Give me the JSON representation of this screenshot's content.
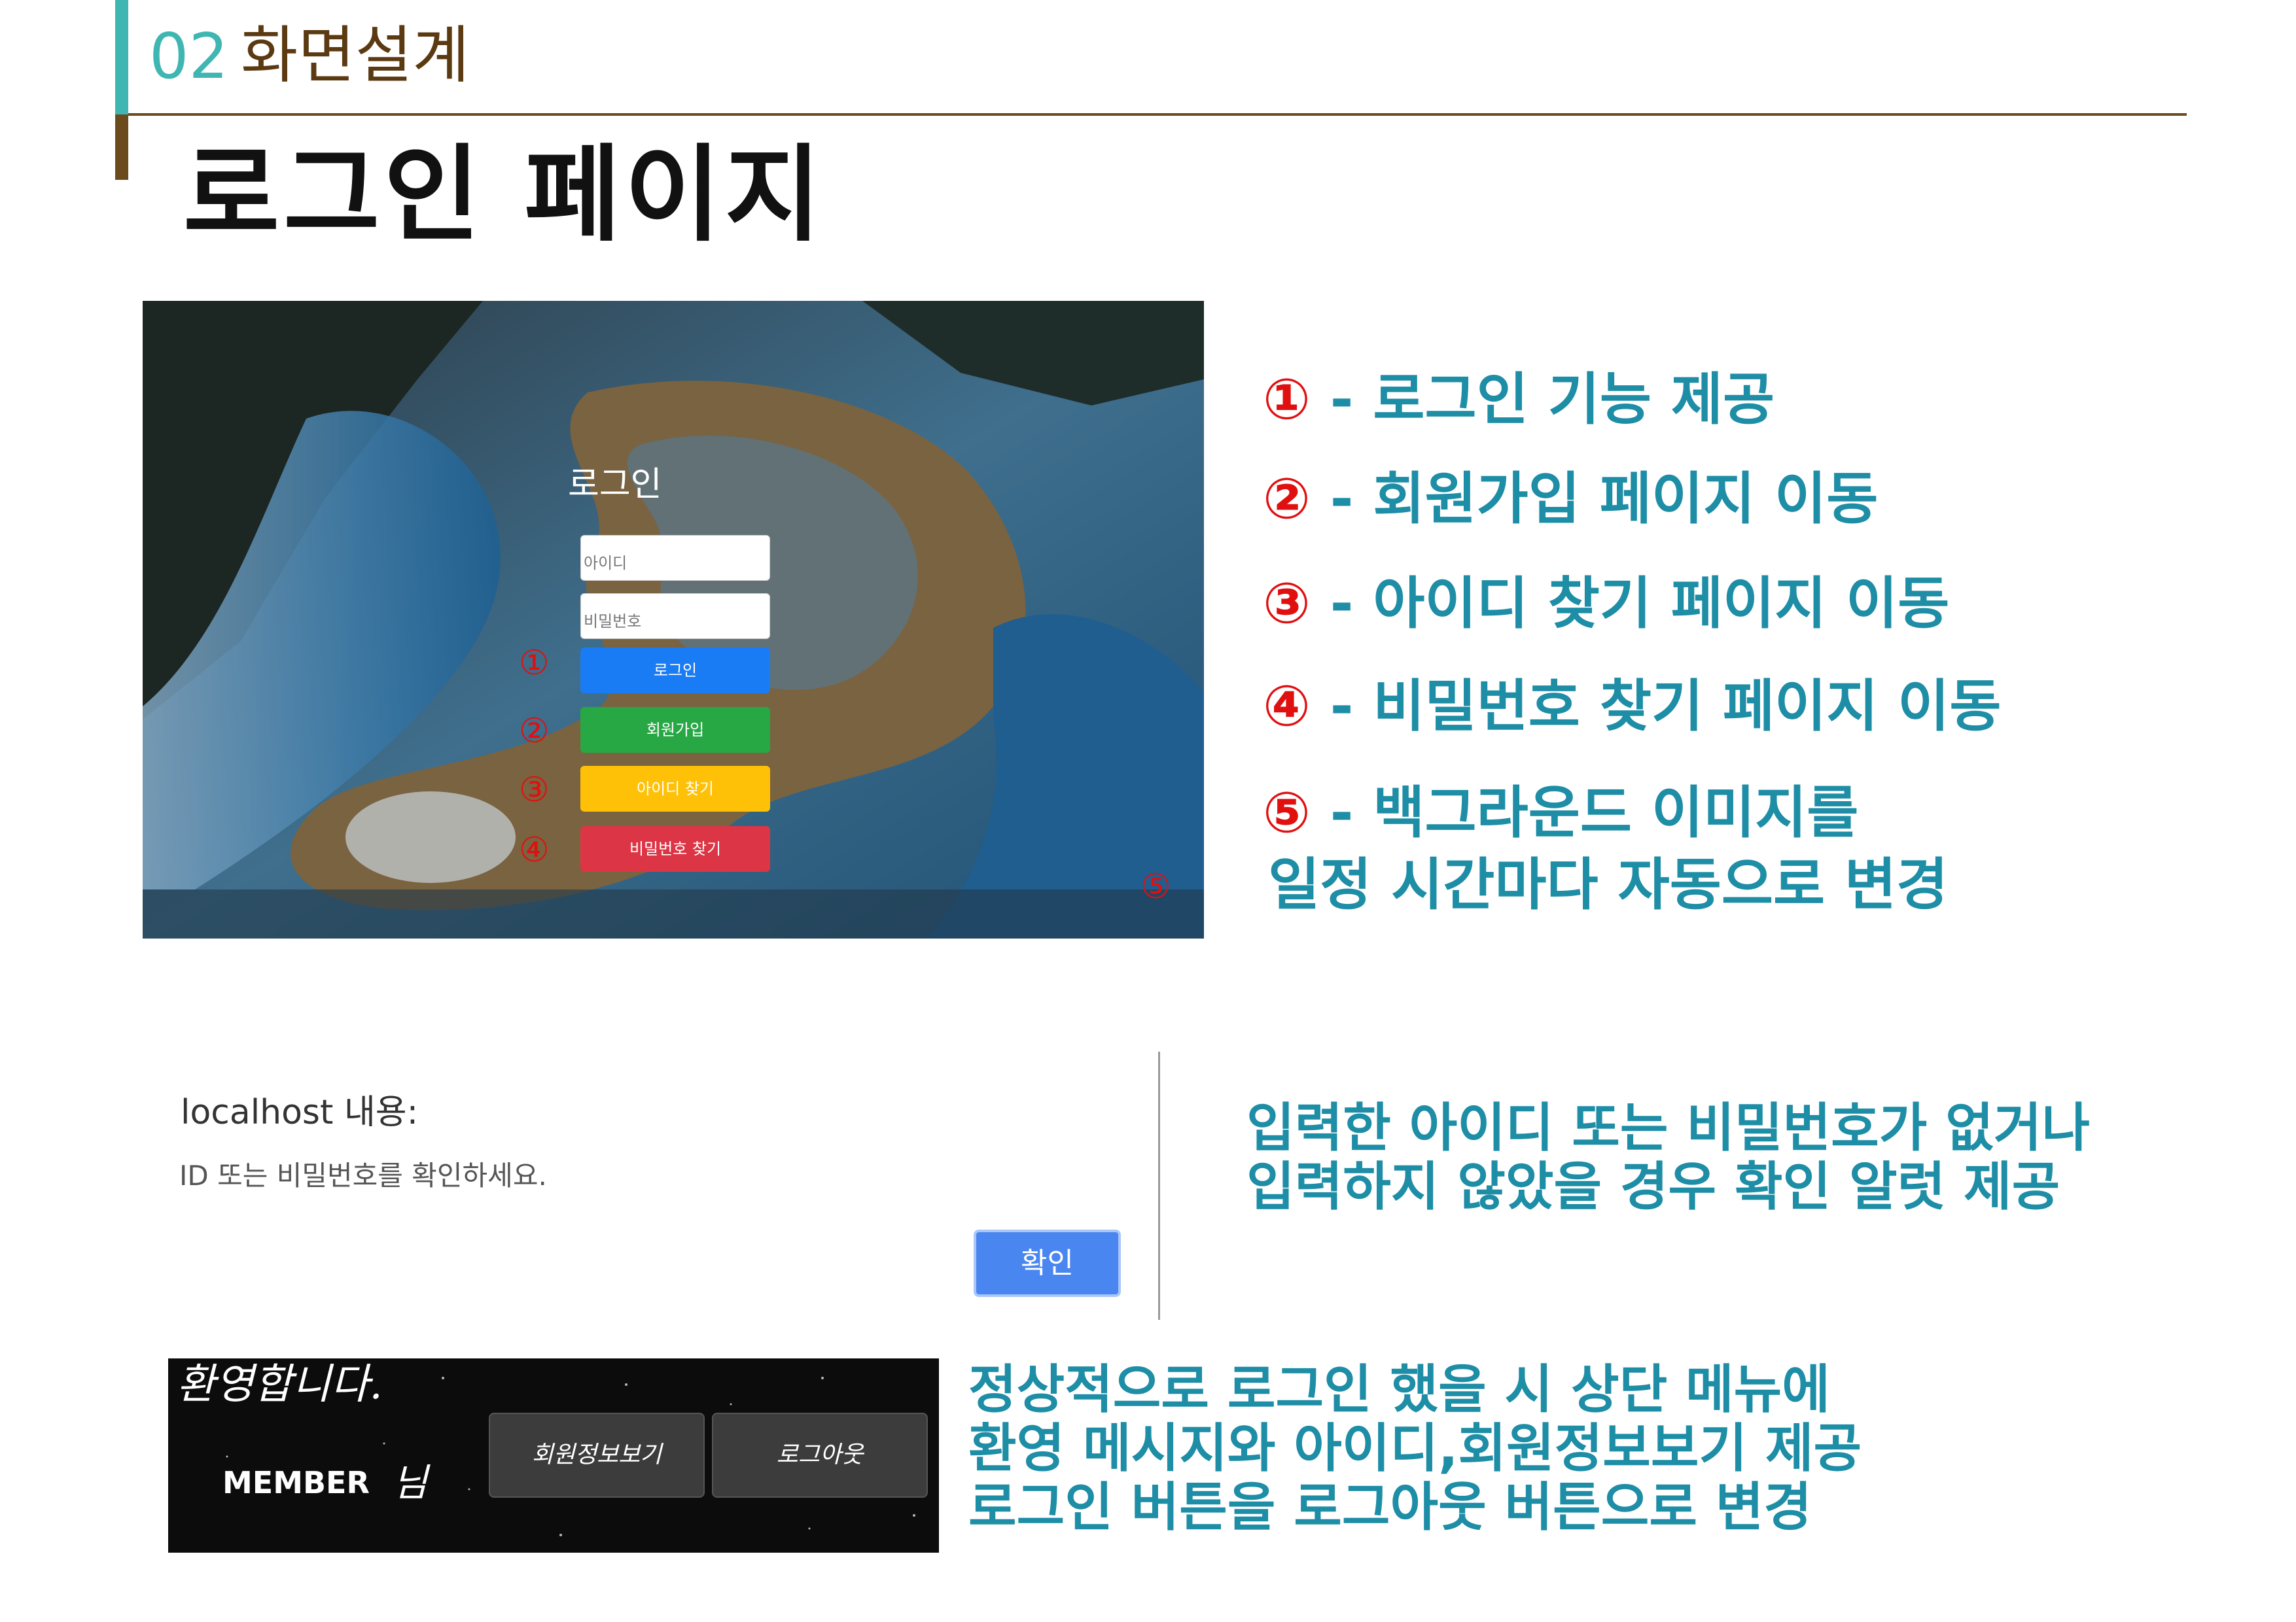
{
  "header": {
    "section_number": "02",
    "section_title": "화면설계",
    "page_title": "로그인 페이지"
  },
  "login_screenshot": {
    "title": "로그인",
    "id_placeholder": "아이디",
    "pw_placeholder": "비밀번호",
    "buttons": [
      {
        "label": "로그인",
        "color": "#1a7cf5"
      },
      {
        "label": "회원가입",
        "color": "#28a745"
      },
      {
        "label": "아이디 찾기",
        "color": "#ffc107"
      },
      {
        "label": "비밀번호 찾기",
        "color": "#dc3545"
      }
    ],
    "markers": [
      "①",
      "②",
      "③",
      "④",
      "⑤"
    ]
  },
  "legend": [
    {
      "num": "①",
      "text": " - 로그인 기능 제공"
    },
    {
      "num": "②",
      "text": " - 회원가입 페이지 이동"
    },
    {
      "num": "③",
      "text": " - 아이디 찾기 페이지 이동"
    },
    {
      "num": "④",
      "text": " - 비밀번호 찾기 페이지 이동"
    },
    {
      "num": "⑤",
      "text": " - 백그라운드 이미지를"
    }
  ],
  "legend_continuation": "일정 시간마다  자동으로 변경",
  "alert_dialog": {
    "title": "localhost 내용:",
    "message": "ID 또는 비밀번호를 확인하세요.",
    "ok_label": "확인"
  },
  "alert_description": [
    "입력한 아이디 또는 비밀번호가 없거나",
    "입력하지 않았을 경우 확인 알럿 제공"
  ],
  "welcome_header": {
    "greeting": "환영합니다.",
    "member_id": "MEMBER",
    "member_suffix": "님",
    "member_info_button": "회원정보보기",
    "logout_button": "로그아웃"
  },
  "welcome_description": [
    "정상적으로 로그인 했을 시 상단 메뉴에",
    "환영 메시지와 아이디,회원정보보기 제공",
    "로그인 버튼을 로그아웃 버튼으로 변경"
  ],
  "colors": {
    "accent_teal": "#3fb6b2",
    "accent_brown": "#6b4a1e",
    "text_blue": "#1e8da6",
    "marker_red": "#e01010"
  }
}
